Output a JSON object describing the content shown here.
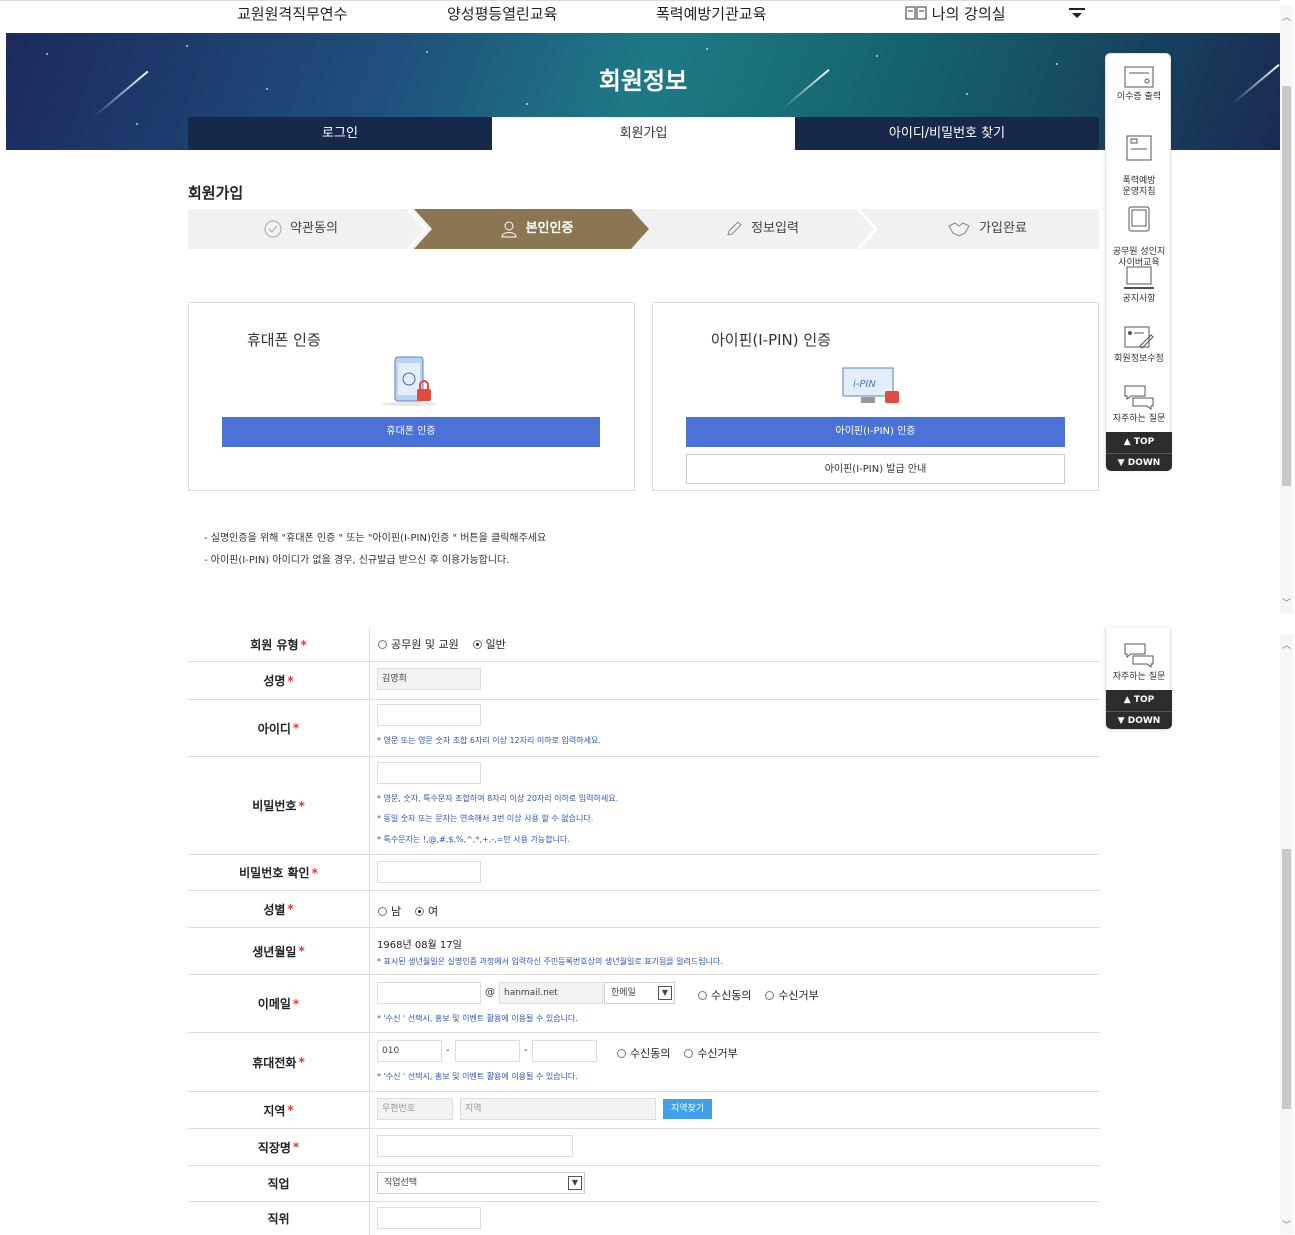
{
  "topnav": {
    "items": [
      "교원원격직무연수",
      "양성평등열린교육",
      "폭력예방기관교육",
      "나의 강의실"
    ]
  },
  "hero": {
    "title": "회원정보",
    "tabs": [
      "로그인",
      "회원가입",
      "아이디/비밀번호 찾기"
    ]
  },
  "section": {
    "title": "회원가입"
  },
  "steps": [
    "약관동의",
    "본인인증",
    "정보입력",
    "가입완료"
  ],
  "auth": {
    "phone": {
      "title": "휴대폰 인증",
      "button": "휴대폰 인증"
    },
    "ipin": {
      "title": "아이핀(I-PIN) 인증",
      "button": "아이핀(I-PIN) 인증",
      "guide_button": "아이핀(I-PIN) 발급 안내",
      "icon_text": "i-PIN"
    }
  },
  "notes": [
    "- 실명인증을 위해 \"휴대폰 인증 \" 또는 \"아이핀(I-PIN)인증 \" 버튼을 클릭해주세요",
    "- 아이핀(I-PIN) 아이디가 없을 경우, 신규발급 받으신 후 이용가능합니다."
  ],
  "quickmenu": {
    "items": [
      "이수증 출력",
      "폭력예방\n운영지침",
      "공무원 성인지\n사이버교육",
      "공지사항",
      "회원정보수정",
      "자주하는 질문"
    ],
    "top": "▲ TOP",
    "down": "▼ DOWN"
  },
  "form": {
    "required_mark": "*",
    "member_type": {
      "label": "회원 유형",
      "options": [
        "공무원 및 교원",
        "일반"
      ],
      "selected": "일반"
    },
    "name": {
      "label": "성명",
      "value": "김영희"
    },
    "userid": {
      "label": "아이디",
      "hint": "* 영문 또는 영문 숫자 조합 6자리 이상 12자리 이하로 입력하세요."
    },
    "password": {
      "label": "비밀번호",
      "hints": [
        "* 영문, 숫자, 특수문자 조합하여 8자리 이상 20자리 이하로 입력하세요.",
        "* 동일 숫자 또는 문자는 연속해서 3번 이상 사용 할 수 없습니다.",
        "* 특수문자는 !,@,#,$,%,^,*,+,-,=만 사용 가능합니다."
      ]
    },
    "password_confirm": {
      "label": "비밀번호 확인"
    },
    "gender": {
      "label": "성별",
      "options": [
        "남",
        "여"
      ],
      "selected": "여"
    },
    "birth": {
      "label": "생년월일",
      "value": "1968년 08월 17일",
      "hint": "* 표시된 생년월일은 실명인증 과정에서 입력하신 주민등록번호상의 생년월일로 표기됨을 알려드립니다."
    },
    "email": {
      "label": "이메일",
      "at": "@",
      "domain": "hanmail.net",
      "domain_select": "한메일",
      "options": [
        "수신동의",
        "수신거부"
      ],
      "hint": "* '수신 ' 선택시, 홍보 및 이벤트 활용에 이용될 수 있습니다."
    },
    "phone": {
      "label": "휴대전화",
      "first": "010",
      "dash": "-",
      "options": [
        "수신동의",
        "수신거부"
      ],
      "hint": "* '수신 ' 선택시, 홍보 및 이벤트 활용에 이용될 수 있습니다."
    },
    "region": {
      "label": "지역",
      "zip_placeholder": "우편번호",
      "region_placeholder": "지역",
      "button": "지역찾기"
    },
    "workplace": {
      "label": "직장명"
    },
    "job": {
      "label": "직업",
      "select": "직업선택"
    },
    "position": {
      "label": "직위"
    }
  }
}
